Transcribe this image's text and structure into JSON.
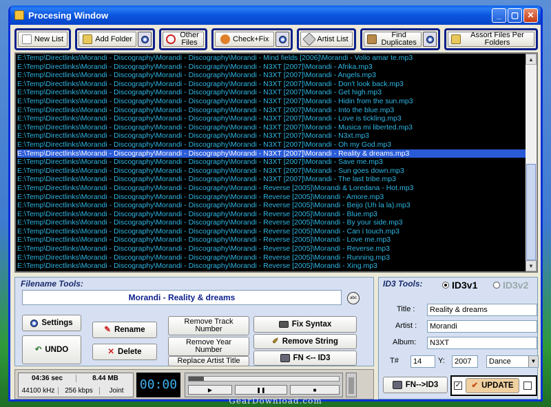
{
  "window": {
    "title": "Procesing Window"
  },
  "toolbar": {
    "new_list": "New List",
    "add_folder": "Add Folder",
    "other_files": "Other Files",
    "check_fix": "Check+Fix",
    "artist_list": "Artist List",
    "find_duplicates": "Find Duplicates",
    "assort_files": "Assort Files Per Folders"
  },
  "files": [
    "E:\\Temp\\Directlinks\\Morandi - Discography\\Morandi - Discography\\Morandi - Mind fields [2006]\\Morandi - Volio amar te.mp3",
    "E:\\Temp\\Directlinks\\Morandi - Discography\\Morandi - Discography\\Morandi - N3XT [2007]\\Morandi - Afrika.mp3",
    "E:\\Temp\\Directlinks\\Morandi - Discography\\Morandi - Discography\\Morandi - N3XT [2007]\\Morandi - Angels.mp3",
    "E:\\Temp\\Directlinks\\Morandi - Discography\\Morandi - Discography\\Morandi - N3XT [2007]\\Morandi - Don't look back.mp3",
    "E:\\Temp\\Directlinks\\Morandi - Discography\\Morandi - Discography\\Morandi - N3XT [2007]\\Morandi - Get high.mp3",
    "E:\\Temp\\Directlinks\\Morandi - Discography\\Morandi - Discography\\Morandi - N3XT [2007]\\Morandi - Hidin from the sun.mp3",
    "E:\\Temp\\Directlinks\\Morandi - Discography\\Morandi - Discography\\Morandi - N3XT [2007]\\Morandi - Into the blue.mp3",
    "E:\\Temp\\Directlinks\\Morandi - Discography\\Morandi - Discography\\Morandi - N3XT [2007]\\Morandi - Love is tickling.mp3",
    "E:\\Temp\\Directlinks\\Morandi - Discography\\Morandi - Discography\\Morandi - N3XT [2007]\\Morandi - Musica mi liberted.mp3",
    "E:\\Temp\\Directlinks\\Morandi - Discography\\Morandi - Discography\\Morandi - N3XT [2007]\\Morandi - N3xt.mp3",
    "E:\\Temp\\Directlinks\\Morandi - Discography\\Morandi - Discography\\Morandi - N3XT [2007]\\Morandi - Oh my God.mp3",
    "E:\\Temp\\Directlinks\\Morandi - Discography\\Morandi - Discography\\Morandi - N3XT [2007]\\Morandi - Reality & dreams.mp3",
    "E:\\Temp\\Directlinks\\Morandi - Discography\\Morandi - Discography\\Morandi - N3XT [2007]\\Morandi - Save me.mp3",
    "E:\\Temp\\Directlinks\\Morandi - Discography\\Morandi - Discography\\Morandi - N3XT [2007]\\Morandi - Sun goes down.mp3",
    "E:\\Temp\\Directlinks\\Morandi - Discography\\Morandi - Discography\\Morandi - N3XT [2007]\\Morandi - The last tribe.mp3",
    "E:\\Temp\\Directlinks\\Morandi - Discography\\Morandi - Discography\\Morandi - Reverse [2005]\\Morandi & Loredana - Hot.mp3",
    "E:\\Temp\\Directlinks\\Morandi - Discography\\Morandi - Discography\\Morandi - Reverse [2005]\\Morandi - Amore.mp3",
    "E:\\Temp\\Directlinks\\Morandi - Discography\\Morandi - Discography\\Morandi - Reverse [2005]\\Morandi - Beijo (Uh la la).mp3",
    "E:\\Temp\\Directlinks\\Morandi - Discography\\Morandi - Discography\\Morandi - Reverse [2005]\\Morandi - Blue.mp3",
    "E:\\Temp\\Directlinks\\Morandi - Discography\\Morandi - Discography\\Morandi - Reverse [2005]\\Morandi - By your side.mp3",
    "E:\\Temp\\Directlinks\\Morandi - Discography\\Morandi - Discography\\Morandi - Reverse [2005]\\Morandi - Can i touch.mp3",
    "E:\\Temp\\Directlinks\\Morandi - Discography\\Morandi - Discography\\Morandi - Reverse [2005]\\Morandi - Love me.mp3",
    "E:\\Temp\\Directlinks\\Morandi - Discography\\Morandi - Discography\\Morandi - Reverse [2005]\\Morandi - Reverse.mp3",
    "E:\\Temp\\Directlinks\\Morandi - Discography\\Morandi - Discography\\Morandi - Reverse [2005]\\Morandi - Running.mp3",
    "E:\\Temp\\Directlinks\\Morandi - Discography\\Morandi - Discography\\Morandi - Reverse [2005]\\Morandi - Xing.mp3"
  ],
  "selected_index": 11,
  "filename_tools": {
    "title": "Filename Tools:",
    "current": "Morandi - Reality & dreams",
    "settings": "Settings",
    "undo": "UNDO",
    "rename": "Rename",
    "delete": "Delete",
    "remove_track": "Remove Track Number",
    "remove_year": "Remove Year Number",
    "replace_artist": "Replace Artist Title",
    "fix_syntax": "Fix Syntax",
    "remove_string": "Remove String",
    "fn_from_id3": "FN <-- ID3"
  },
  "id3": {
    "title": "ID3 Tools:",
    "v1": "ID3v1",
    "v2": "ID3v2",
    "selected": "ID3v1",
    "title_label": "Title :",
    "title_value": "Reality & dreams",
    "artist_label": "Artist :",
    "artist_value": "Morandi",
    "album_label": "Album:",
    "album_value": "N3XT",
    "track_label": "T#",
    "track_value": "14",
    "year_label": "Y:",
    "year_value": "2007",
    "genre_value": "Dance",
    "fn_to_id3": "FN-->ID3",
    "update": "UPDATE",
    "update_checked": true
  },
  "status": {
    "duration": "04:36 sec",
    "size": "8.44 MB",
    "sample_rate": "44100 kHz",
    "bitrate": "256 kbps",
    "mode": "Joint",
    "timer": "00:00",
    "progress": 0.1
  },
  "watermark": "GearDownload.com",
  "colors": {
    "list_text": "#2fb8e6",
    "list_bg": "#000000",
    "selection": "#2a5bd7",
    "title_bar": "#0a5fe8"
  }
}
